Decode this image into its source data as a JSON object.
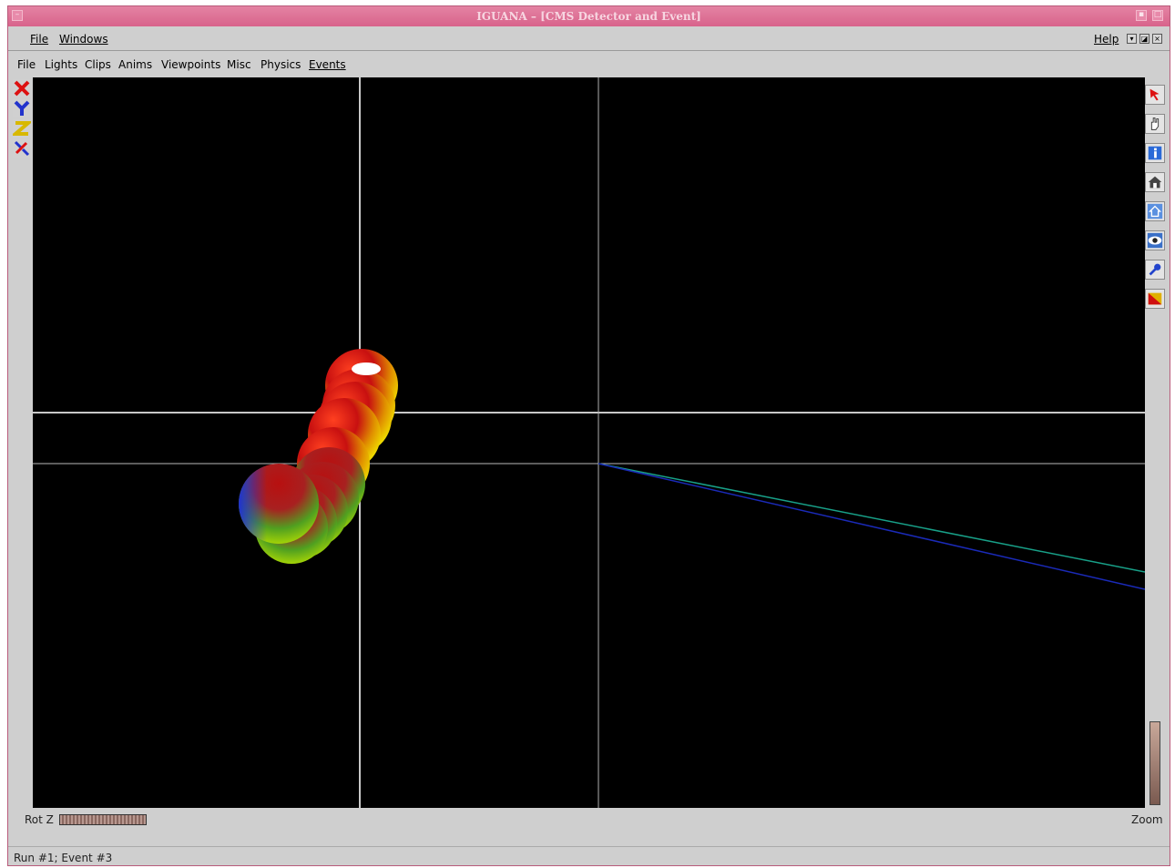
{
  "window": {
    "title": "IGUANA – [CMS Detector and Event]"
  },
  "top_menu": {
    "file": "File",
    "windows": "Windows",
    "help": "Help"
  },
  "view_menu": {
    "items": [
      "File",
      "Lights",
      "Clips",
      "Anims",
      "Viewpoints",
      "Misc",
      "Physics",
      "Events"
    ]
  },
  "left_tools": [
    "x-axis-icon",
    "y-axis-icon",
    "z-axis-icon",
    "seek-icon"
  ],
  "right_tools": [
    "select-arrow-icon",
    "pan-hand-icon",
    "info-icon",
    "home-icon",
    "set-home-icon",
    "view-all-eye-icon",
    "seek-tool-icon",
    "projection-icon"
  ],
  "controls": {
    "rot_z_label": "Rot Z",
    "zoom_label": "Zoom"
  },
  "status": {
    "text": "Run #1; Event #3"
  },
  "colors": {
    "titlebar": "#d8638b",
    "track_green": "#1aa08a",
    "track_blue": "#1a2aa8"
  }
}
